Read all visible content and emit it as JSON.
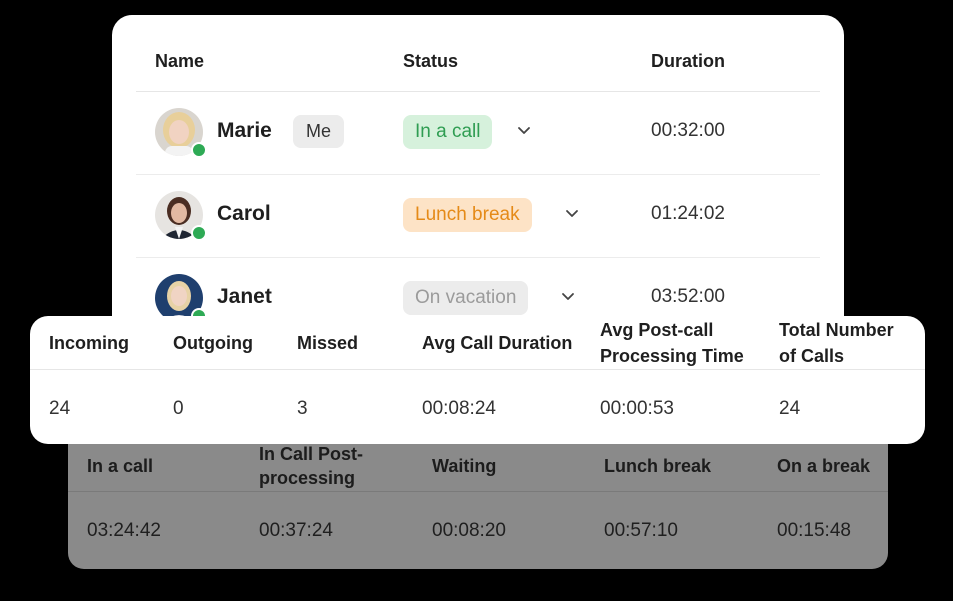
{
  "agents_table": {
    "headers": {
      "name": "Name",
      "status": "Status",
      "duration": "Duration"
    },
    "rows": [
      {
        "name": "Marie",
        "badge": "Me",
        "status": "In a call",
        "status_color": "#2f9d52",
        "duration": "00:32:00",
        "online": true
      },
      {
        "name": "Carol",
        "badge": "",
        "status": "Lunch break",
        "status_color": "#e58a17",
        "duration": "01:24:02",
        "online": true
      },
      {
        "name": "Janet",
        "badge": "",
        "status": "On vacation",
        "status_color": "#9b9b9b",
        "duration": "03:52:00",
        "online": true
      }
    ]
  },
  "call_stats": {
    "headers": {
      "incoming": "Incoming",
      "outgoing": "Outgoing",
      "missed": "Missed",
      "avg_call_duration": "Avg Call Duration",
      "avg_post_call_line1": "Avg Post-call",
      "avg_post_call_line2": "Processing Time",
      "total_calls_line1": "Total Number",
      "total_calls_line2": "of Calls"
    },
    "values": {
      "incoming": "24",
      "outgoing": "0",
      "missed": "3",
      "avg_call_duration": "00:08:24",
      "avg_post_call": "00:00:53",
      "total_calls": "24"
    }
  },
  "status_times": {
    "headers": {
      "in_a_call": "In a call",
      "post_processing_line1": "In Call Post-",
      "post_processing_line2": "processing",
      "waiting": "Waiting",
      "lunch_break": "Lunch break",
      "on_a_break": "On a break"
    },
    "values": {
      "in_a_call": "03:24:42",
      "post_processing": "00:37:24",
      "waiting": "00:08:20",
      "lunch_break": "00:57:10",
      "on_a_break": "00:15:48"
    }
  },
  "colors": {
    "online": "#2eaa55",
    "in_call_bg": "#d6f1dc",
    "lunch_bg": "#fde3c6",
    "vacation_bg": "#ececec"
  }
}
